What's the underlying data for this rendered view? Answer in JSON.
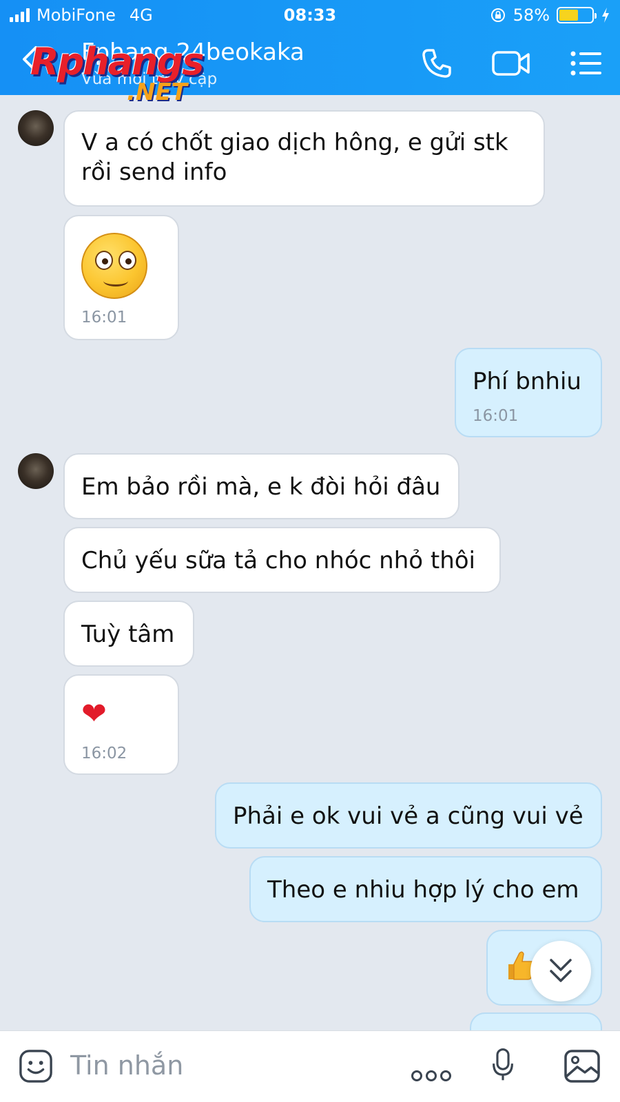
{
  "status_bar": {
    "carrier": "MobiFone",
    "network": "4G",
    "time": "08:33",
    "battery_percent": "58%",
    "battery_level": 0.58
  },
  "header": {
    "contact_name": "Fphang 24beokaka",
    "contact_status": "Vừa mới truy cập",
    "watermark_top": "Rphangs",
    "watermark_bottom": ".NET",
    "icons": [
      "back-icon",
      "phone-icon",
      "video-call-icon",
      "menu-list-icon"
    ]
  },
  "messages": [
    {
      "side": "in",
      "type": "text",
      "text": "V a có chốt giao dịch hông, e gửi stk rồi send info"
    },
    {
      "side": "in",
      "type": "emoji",
      "emoji": "surprised-face-sticker",
      "time": "16:01"
    },
    {
      "side": "out",
      "type": "text",
      "text": "Phí bnhiu",
      "time": "16:01"
    },
    {
      "side": "in",
      "type": "text",
      "text": "Em bảo rồi mà, e k đòi hỏi đâu"
    },
    {
      "side": "in",
      "type": "text",
      "text": "Chủ yếu sữa tả cho nhóc nhỏ thôi"
    },
    {
      "side": "in",
      "type": "text",
      "text": "Tuỳ tâm"
    },
    {
      "side": "in",
      "type": "emoji",
      "emoji": "red-heart",
      "time": "16:02"
    },
    {
      "side": "out",
      "type": "text",
      "text": "Phải e ok vui vẻ a cũng vui vẻ"
    },
    {
      "side": "out",
      "type": "text",
      "text": "Theo e nhiu hợp lý cho em"
    },
    {
      "side": "out",
      "type": "emoji",
      "emoji": "thumbs-up"
    }
  ],
  "composer": {
    "placeholder": "Tin nhắn",
    "icons": [
      "sticker-icon",
      "more-icon",
      "microphone-icon",
      "image-icon"
    ]
  },
  "colors": {
    "header": "#1a9af7",
    "incoming_bubble": "#ffffff",
    "outgoing_bubble": "#d6f0fe",
    "background": "#e3e8ef"
  }
}
